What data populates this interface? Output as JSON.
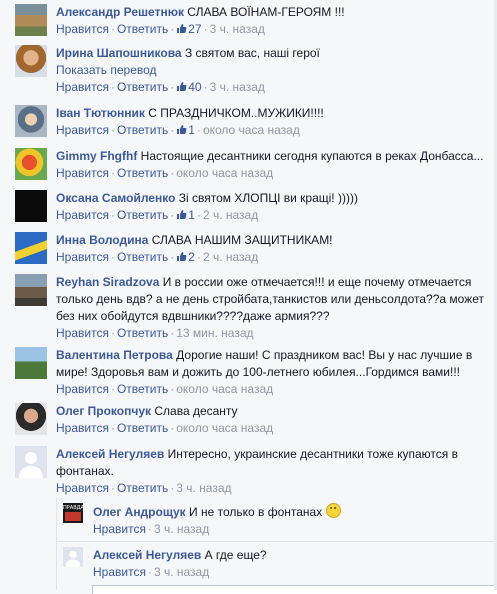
{
  "comments": [
    {
      "author": "Александр Решетнюк",
      "text": "СЛАВА ВОЇНАМ-ГЕРОЯМ !!!",
      "like": "Нравится",
      "reply": "Ответить",
      "likes": "27",
      "time": "3 ч. назад"
    },
    {
      "author": "Ирина Шапошникова",
      "text": "З святом вас, наші герої",
      "translate": "Показать перевод",
      "like": "Нравится",
      "reply": "Ответить",
      "likes": "40",
      "time": "3 ч. назад"
    },
    {
      "author": "Іван Тютюнник",
      "text": "С ПРАЗДНИЧКОМ..МУЖИКИ!!!!",
      "like": "Нравится",
      "reply": "Ответить",
      "likes": "1",
      "time": "около часа назад"
    },
    {
      "author": "Gimmy Fhgfhf",
      "text": "Настоящие десантники сегодня купаются в реках Донбасса...",
      "like": "Нравится",
      "reply": "Ответить",
      "likes": "",
      "time": "около часа назад"
    },
    {
      "author": "Оксана Самойленко",
      "text": "Зі святом ХЛОПЦІ ви кращі! )))))",
      "like": "Нравится",
      "reply": "Ответить",
      "likes": "1",
      "time": "2 ч. назад"
    },
    {
      "author": "Инна Володина",
      "text": "СЛАВА НАШИМ ЗАЩИТНИКАМ!",
      "like": "Нравится",
      "reply": "Ответить",
      "likes": "2",
      "time": "2 ч. назад"
    },
    {
      "author": "Reyhan Siradzova",
      "text": "И в россии оже отмечается!!! и еще почему отмечается только день вдв? а не день стройбата,танкистов или деньсолдота??а может без них обойдутся вдвшники????даже армия???",
      "like": "Нравится",
      "reply": "Ответить",
      "likes": "",
      "time": "13 мин. назад"
    },
    {
      "author": "Валентина Петрова",
      "text": "Дорогие наши! С праздником вас! Вы у нас лучшие в мире! Здоровья вам и дожить до 100-летнего юбилея...Гордимся вами!!!",
      "like": "Нравится",
      "reply": "Ответить",
      "likes": "",
      "time": "около часа назад"
    },
    {
      "author": "Олег Прокопчук",
      "text": "Слава десанту",
      "like": "Нравится",
      "reply": "Ответить",
      "likes": "",
      "time": "около часа назад"
    },
    {
      "author": "Алексей Негуляев",
      "text": "Интересно, украинские десантники тоже купаются в фонтанах.",
      "like": "Нравится",
      "reply": "Ответить",
      "likes": "",
      "time": "3 ч. назад"
    }
  ],
  "replies": [
    {
      "author": "Олег Андрощук",
      "text": "И не только в фонтанах",
      "like": "Нравится",
      "time": "3 ч. назад"
    },
    {
      "author": "Алексей Негуляев",
      "text": "А где еще?",
      "like": "Нравится",
      "time": "3 ч. назад"
    }
  ],
  "avatar_badge": "ПРАВДА"
}
